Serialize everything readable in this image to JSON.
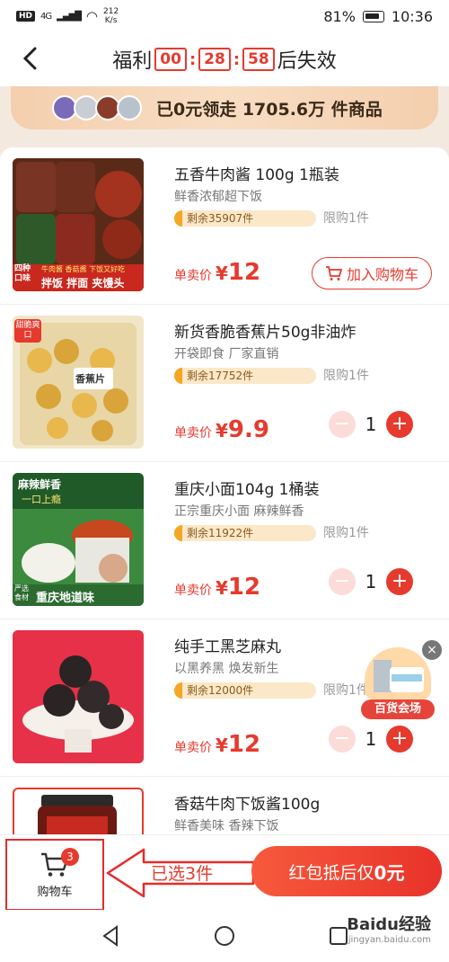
{
  "status": {
    "network": "4G",
    "speed_value": "212",
    "speed_unit": "K/s",
    "battery": "81%",
    "time": "10:36"
  },
  "header": {
    "prefix": "福利",
    "h": "00",
    "m": "28",
    "s": "58",
    "suffix": "后失效"
  },
  "banner": {
    "text": "已0元领走 1705.6万 件商品"
  },
  "products": [
    {
      "name": "五香牛肉酱 100g 1瓶装",
      "desc": "鲜香浓郁超下饭",
      "stock": "剩余35907件",
      "limit": "限购1件",
      "price_label": "单卖价",
      "price": "12",
      "action": "加入购物车"
    },
    {
      "name": "新货香脆香蕉片50g非油炸",
      "desc": "开袋即食 厂家直销",
      "stock": "剩余17752件",
      "limit": "限购1件",
      "price_label": "单卖价",
      "price": "9.9",
      "qty": "1"
    },
    {
      "name": "重庆小面104g 1桶装",
      "desc": "正宗重庆小面 麻辣鲜香",
      "stock": "剩余11922件",
      "limit": "限购1件",
      "price_label": "单卖价",
      "price": "12",
      "qty": "1"
    },
    {
      "name": "纯手工黑芝麻丸",
      "desc": "以黑养黑 焕发新生",
      "stock": "剩余12000件",
      "limit": "限购1件",
      "price_label": "单卖价",
      "price": "12",
      "qty": "1"
    },
    {
      "name": "香菇牛肉下饭酱100g",
      "desc": "鲜香美味 香辣下饭"
    }
  ],
  "thumb_texts": {
    "p1_side": "四种口味",
    "p1_bottom": "拌饭 拌面 夹馒头",
    "p1_banner": "牛肉酱 香菇酱 下饭又好吃",
    "p2_tag": "甜脆爽口",
    "p2_label": "香蕉片",
    "p3_top1": "麻辣鲜香",
    "p3_top2": "一口上瘾",
    "p3_bottom": "重庆地道味",
    "p3_tag": "严选食材"
  },
  "floating": {
    "label": "百货会场",
    "close": "×"
  },
  "bottom": {
    "cart_label": "购物车",
    "cart_count": "3",
    "selected": "已选3件",
    "checkout_prefix": "红包抵后仅",
    "checkout_amount": "0元"
  },
  "watermark": {
    "brand": "Baidu经验",
    "url": "jingyan.baidu.com"
  },
  "colors": {
    "accent": "#e63a2e",
    "stock_bg": "#fbe8c9",
    "stock_bar": "#f5a623"
  },
  "icons": [
    "back-icon",
    "cart-icon",
    "minus-icon",
    "plus-icon",
    "close-icon"
  ]
}
